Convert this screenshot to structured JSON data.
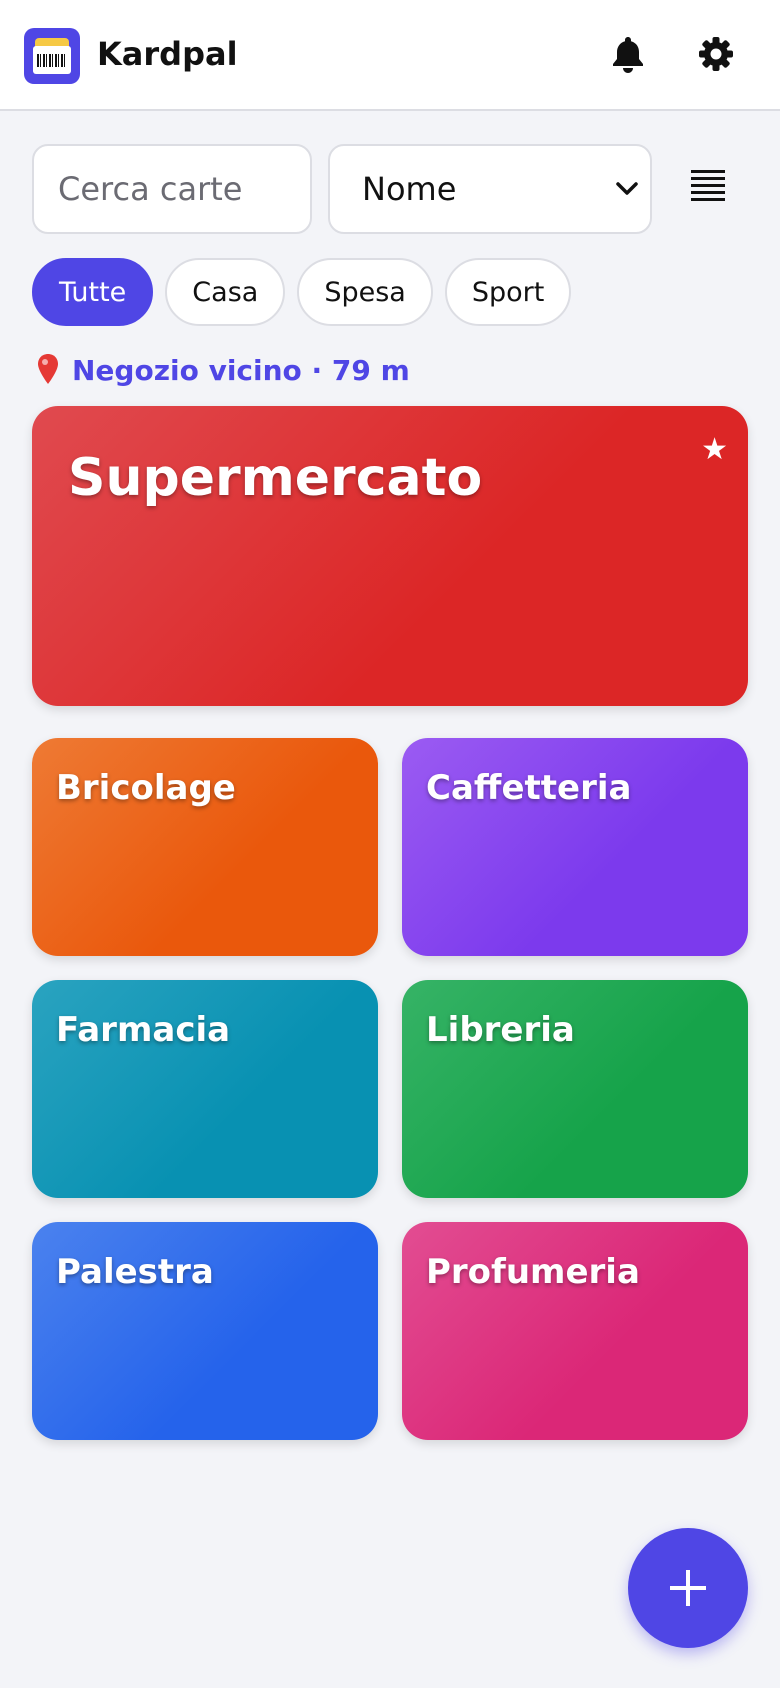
{
  "app": {
    "title": "Kardpal"
  },
  "header": {
    "notifications_icon": "bell-icon",
    "settings_icon": "gear-icon"
  },
  "search": {
    "placeholder": "Cerca carte",
    "value": ""
  },
  "sort": {
    "selected": "Nome"
  },
  "view_toggle_icon": "list-icon",
  "filters": [
    {
      "label": "Tutte",
      "active": true
    },
    {
      "label": "Casa",
      "active": false
    },
    {
      "label": "Spesa",
      "active": false
    },
    {
      "label": "Sport",
      "active": false
    }
  ],
  "nearby": {
    "text": "Negozio vicino · 79 m",
    "icon": "pin-icon"
  },
  "featured_card": {
    "name": "Supermercato",
    "favorite": true,
    "color_from": "#e04a4f",
    "color_to": "#dc2626"
  },
  "cards": [
    {
      "name": "Bricolage",
      "color_from": "#ee7a34",
      "color_to": "#ea580c"
    },
    {
      "name": "Caffetteria",
      "color_from": "#9b5bf2",
      "color_to": "#7c3aed"
    },
    {
      "name": "Farmacia",
      "color_from": "#2aa3c0",
      "color_to": "#0891b2"
    },
    {
      "name": "Libreria",
      "color_from": "#36b366",
      "color_to": "#16a34a"
    },
    {
      "name": "Palestra",
      "color_from": "#4b82ee",
      "color_to": "#2563eb"
    },
    {
      "name": "Profumeria",
      "color_from": "#e24d92",
      "color_to": "#db2777"
    }
  ],
  "fab": {
    "icon": "plus-icon"
  },
  "colors": {
    "accent": "#4f46e5",
    "background": "#f3f4f8"
  }
}
